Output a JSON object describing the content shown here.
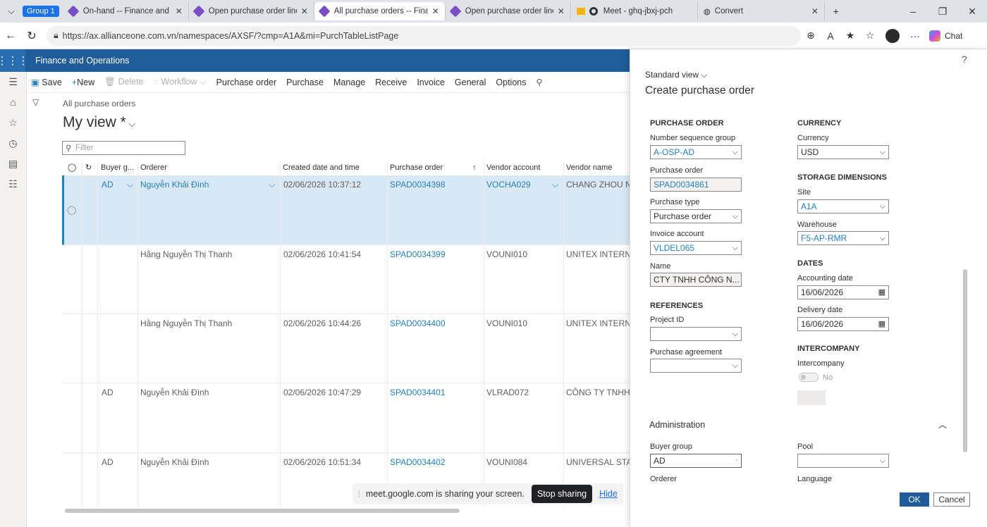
{
  "browser": {
    "group_label": "Group 1",
    "tabs": [
      {
        "title": "On-hand -- Finance and Op",
        "active": false
      },
      {
        "title": "Open purchase order lines",
        "active": false
      },
      {
        "title": "All purchase orders -- Finan",
        "active": true
      },
      {
        "title": "Open purchase order lines",
        "active": false
      },
      {
        "title": "Meet - ghq-jbxj-pch",
        "active": false
      },
      {
        "title": "Convert",
        "active": false
      }
    ],
    "url": "https://ax.allianceone.com.vn/namespaces/AXSF/?cmp=A1A&mi=PurchTableListPage",
    "chat_label": "Chat"
  },
  "app": {
    "name": "Finance and Operations"
  },
  "actionbar": {
    "items": [
      "Save",
      "New",
      "Delete",
      "Workflow",
      "Purchase order",
      "Purchase",
      "Manage",
      "Receive",
      "Invoice",
      "General",
      "Options"
    ]
  },
  "listpage": {
    "breadcrumb": "All purchase orders",
    "view_title": "My view *",
    "filter_placeholder": "Filter",
    "columns": [
      "Buyer g...",
      "Orderer",
      "Created date and time",
      "Purchase order",
      "Vendor account",
      "Vendor name"
    ],
    "rows": [
      {
        "buyer": "AD",
        "orderer": "Nguyễn Khải Đình",
        "created": "02/06/2026 10:37:12",
        "po": "SPAD0034398",
        "vendor": "VOCHA029",
        "vendor_name": "CHANG ZHOU N",
        "selected": true
      },
      {
        "buyer": "",
        "orderer": "Hằng Nguyễn Thị Thanh",
        "created": "02/06/2026 10:41:54",
        "po": "SPAD0034399",
        "vendor": "VOUNI010",
        "vendor_name": "UNITEX INTERNA",
        "selected": false
      },
      {
        "buyer": "",
        "orderer": "Hằng Nguyễn Thị Thanh",
        "created": "02/06/2026 10:44:26",
        "po": "SPAD0034400",
        "vendor": "VOUNI010",
        "vendor_name": "UNITEX INTERNA",
        "selected": false
      },
      {
        "buyer": "AD",
        "orderer": "Nguyễn Khải Đình",
        "created": "02/06/2026 10:47:29",
        "po": "SPAD0034401",
        "vendor": "VLRAD072",
        "vendor_name": "CÔNG TY TNHH",
        "selected": false
      },
      {
        "buyer": "AD",
        "orderer": "Nguyễn Khải Đình",
        "created": "02/06/2026 10:51:34",
        "po": "SPAD0034402",
        "vendor": "VOUNI084",
        "vendor_name": "UNIVERSAL STAR",
        "selected": false
      }
    ]
  },
  "share_banner": {
    "text": "meet.google.com is sharing your screen.",
    "stop_label": "Stop sharing",
    "hide_label": "Hide"
  },
  "pane": {
    "help": "?",
    "view_label": "Standard view",
    "title": "Create purchase order",
    "purchase_order": {
      "section": "PURCHASE ORDER",
      "nsg_label": "Number sequence group",
      "nsg_value": "A-OSP-AD",
      "po_label": "Purchase order",
      "po_value": "SPAD0034861",
      "type_label": "Purchase type",
      "type_value": "Purchase order",
      "invoice_label": "Invoice account",
      "invoice_value": "VLDEL065",
      "name_label": "Name",
      "name_value": "CTY TNHH CÔNG N..."
    },
    "references": {
      "section": "REFERENCES",
      "project_label": "Project ID",
      "project_value": "",
      "agreement_label": "Purchase agreement",
      "agreement_value": ""
    },
    "currency": {
      "section": "CURRENCY",
      "label": "Currency",
      "value": "USD"
    },
    "storage": {
      "section": "STORAGE DIMENSIONS",
      "site_label": "Site",
      "site_value": "A1A",
      "wh_label": "Warehouse",
      "wh_value": "F5-AP-RMR"
    },
    "dates": {
      "section": "DATES",
      "acct_label": "Accounting date",
      "acct_value": "16/06/2026",
      "deliv_label": "Delivery date",
      "deliv_value": "16/06/2026"
    },
    "intercompany": {
      "section": "INTERCOMPANY",
      "label": "Intercompany",
      "value": "No"
    },
    "admin": {
      "title": "Administration",
      "buyer_label": "Buyer group",
      "buyer_value": "AD",
      "pool_label": "Pool",
      "pool_value": "",
      "orderer_label": "Orderer",
      "language_label": "Language"
    },
    "ok_label": "OK",
    "cancel_label": "Cancel"
  }
}
